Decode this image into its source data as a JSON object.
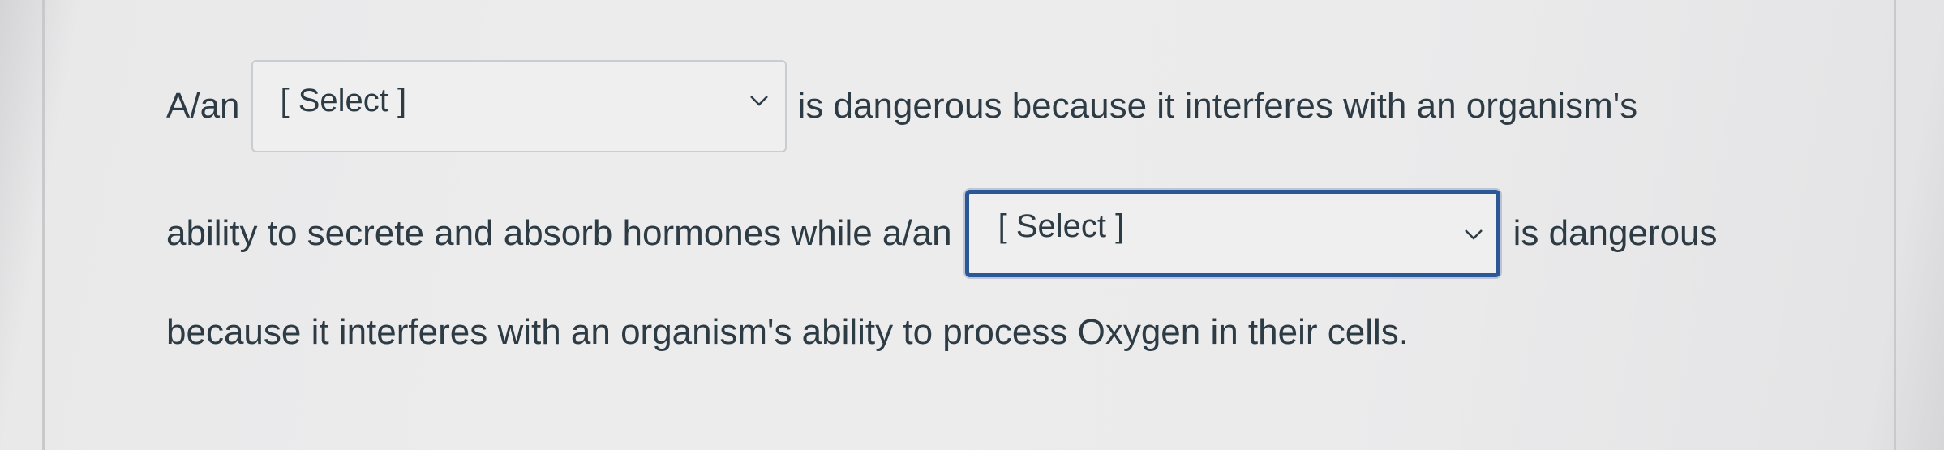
{
  "question": {
    "line1_prefix": "A/an",
    "select1_value": "[ Select ]",
    "line1_suffix": "is dangerous because it interferes with an organism's",
    "line2_prefix": "ability to secrete and absorb hormones while a/an",
    "select2_value": "[ Select ]",
    "line2_suffix": "is dangerous",
    "line3": "because it interferes with an organism's ability to process Oxygen in their cells."
  },
  "icons": {
    "select1_chevron": "chevron-down-icon",
    "select2_chevron": "chevron-down-icon"
  },
  "colors": {
    "text": "#2d3b45",
    "focus_border": "#2b5796",
    "select_border": "#c7cdd1"
  }
}
